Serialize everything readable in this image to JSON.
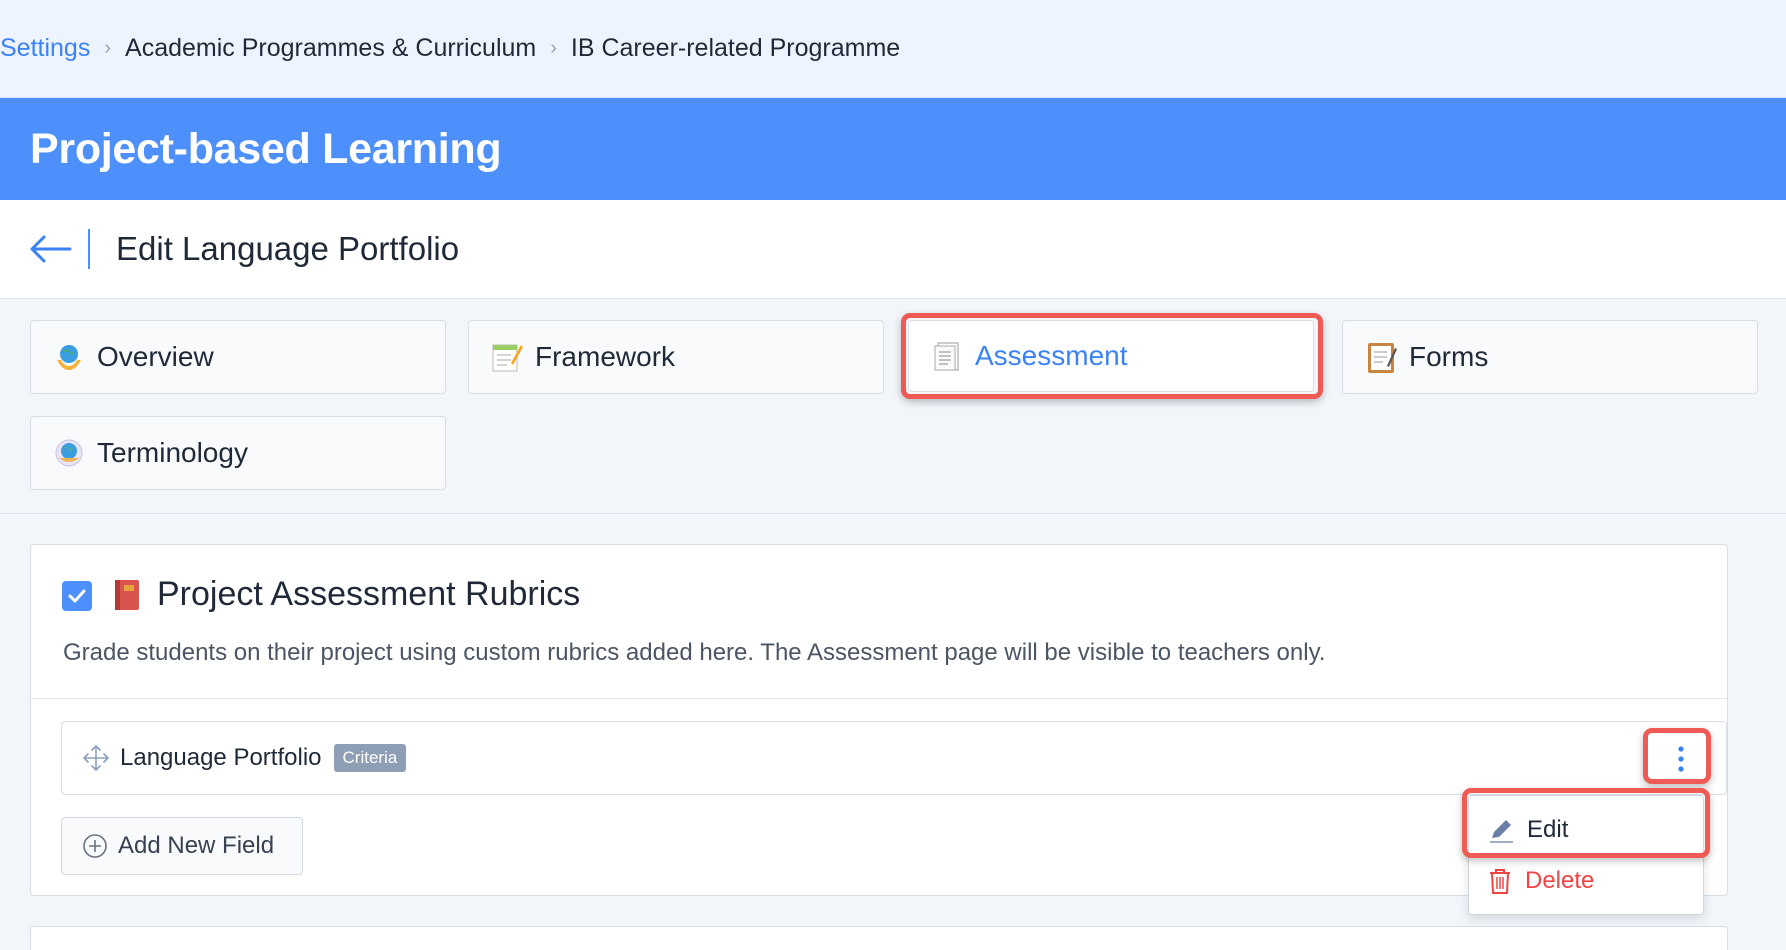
{
  "breadcrumb": {
    "items": [
      "Settings",
      "Academic Programmes & Curriculum",
      "IB Career-related Programme"
    ]
  },
  "header": {
    "title": "Project-based Learning"
  },
  "subheader": {
    "title": "Edit Language Portfolio"
  },
  "tabs": [
    {
      "label": "Overview",
      "icon": "globe-hands-icon"
    },
    {
      "label": "Framework",
      "icon": "memo-pencil-icon"
    },
    {
      "label": "Assessment",
      "icon": "notepad-icon",
      "active": true
    },
    {
      "label": "Forms",
      "icon": "clipboard-icon"
    },
    {
      "label": "Terminology",
      "icon": "globe-icon"
    }
  ],
  "section": {
    "checked": true,
    "title": "Project Assessment Rubrics",
    "description": "Grade students on their project using custom rubrics added here. The Assessment page will be visible to teachers only.",
    "field": {
      "name": "Language Portfolio",
      "badge": "Criteria"
    },
    "add_button": "Add New Field"
  },
  "menu": {
    "edit": "Edit",
    "delete": "Delete"
  },
  "colors": {
    "brand": "#4d8ffb",
    "link": "#3b82f6",
    "highlight": "#ef5a55",
    "danger": "#ef4444"
  }
}
